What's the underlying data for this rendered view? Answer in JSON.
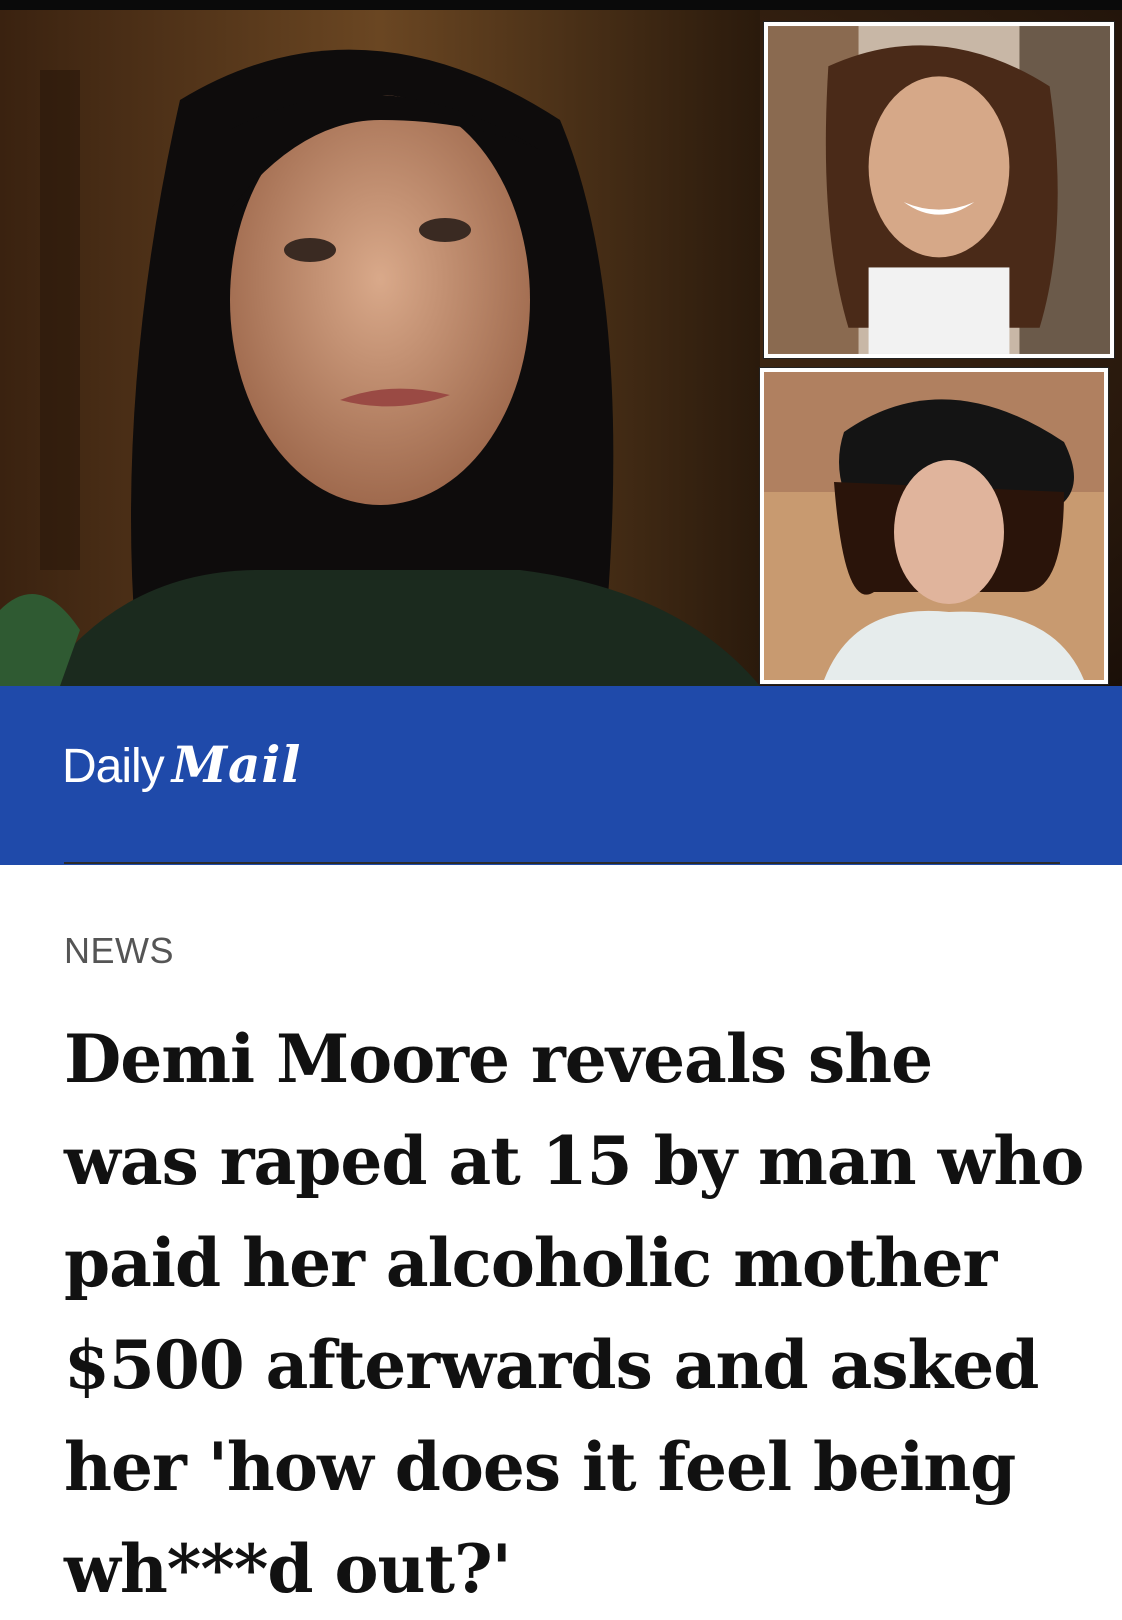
{
  "hero": {
    "main_photo": "woman-portrait",
    "inset_photos": [
      "teen-girl-smiling-photo",
      "young-woman-hat-photo"
    ]
  },
  "brand": {
    "logo_daily": "Daily",
    "logo_mail": "Mail",
    "bar_color": "#1f4aaa"
  },
  "article": {
    "section": "NEWS",
    "headline": "Demi Moore reveals she was raped at 15 by man who paid her alcoholic mother $500 afterwards and asked her 'how does it feel being wh***d out?'"
  }
}
